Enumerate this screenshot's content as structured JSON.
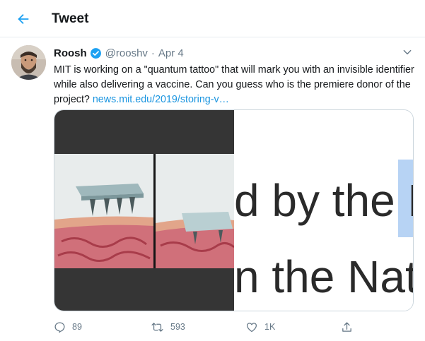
{
  "header": {
    "title": "Tweet"
  },
  "tweet": {
    "author": "Roosh",
    "handle": "@rooshv",
    "separator": "·",
    "date": "Apr 4",
    "text": "MIT is working on a \"quantum tattoo\" that will mark you with an invisible identifier while also delivering a vaccine. Can you guess who is the premiere donor of the project?",
    "link": "news.mit.edu/2019/storing-v…",
    "media": {
      "line1": "d by the E",
      "line2": "n the Nat"
    }
  },
  "actions": {
    "reply_count": "89",
    "retweet_count": "593",
    "like_count": "1K"
  },
  "colors": {
    "accent": "#1da1f2",
    "link": "#1b95e0",
    "muted": "#657786"
  }
}
